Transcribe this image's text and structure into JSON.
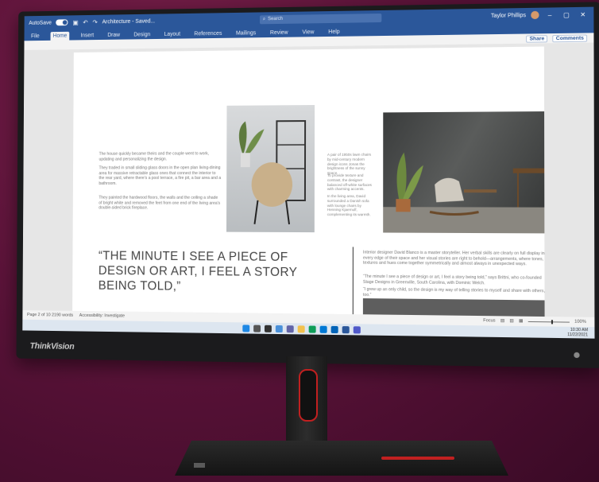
{
  "window": {
    "autosave_label": "AutoSave",
    "autosave_state": "On",
    "doc_title": "Architecture - Saved...",
    "search_placeholder": "Search",
    "user_name": "Taylor Phillips"
  },
  "ribbon_tabs": [
    "File",
    "Home",
    "Insert",
    "Draw",
    "Design",
    "Layout",
    "References",
    "Mailings",
    "Review",
    "View",
    "Help"
  ],
  "active_tab_index": 1,
  "share_label": "Share",
  "comments_label": "Comments",
  "document": {
    "left_para_1": "The house quickly became theirs and the couple went to work, updating and personalizing the design.",
    "left_para_2": "They traded in small sliding glass doors in the open plan living-dining area for massive retractable glass ones that connect the interior to the rear yard, where there's a pool terrace, a fire pit, a bar area and a bathroom.",
    "left_para_3": "They painted the hardwood floors, the walls and the ceiling a shade of bright white and removed the feet from one end of the living area's double-sided brick fireplace.",
    "caption_1": "A pair of 1950s lawn chairs by mid-century modern design icons Jonas the brightness of the sunny space.",
    "caption_2": "To provide texture and contrast, the designer balanced off-white surfaces with charming accents.",
    "caption_3": "In the living area, David surrounded a Danish sofa with lounge chairs by Henning Kjaernulf, complementing its warmth.",
    "quote": "“THE MINUTE I SEE A PIECE OF DESIGN OR ART, I FEEL A STORY BEING TOLD,”",
    "right_para_1": "Interior designer David Blanco is a master storyteller. Her verbal skills are clearly on full display in every edge of their space and her visual stories are right to behold—arrangements, where tones, textures and hues come together symmetrically and almost always in unexpected ways.",
    "right_para_2": "“The minute I see a piece of design or art, I feel a story being told,” says Brittni, who co-founded Stage Designs in Greenville, South Carolina, with Dominic Welch.",
    "right_para_3": "“I grew up an only child, so the design is my way of telling stories to myself and share with others, too.”"
  },
  "status": {
    "page_info": "Page 2 of 10  2190 words",
    "accessibility": "Accessibility: Investigate",
    "focus": "Focus",
    "zoom": "100%"
  },
  "tray": {
    "time": "10:30 AM",
    "date": "11/22/2021"
  },
  "monitor": {
    "brand": "ThinkVision"
  },
  "colors": {
    "word_blue": "#2b579a",
    "accent_red": "#c12020",
    "background": "#5a1238"
  }
}
